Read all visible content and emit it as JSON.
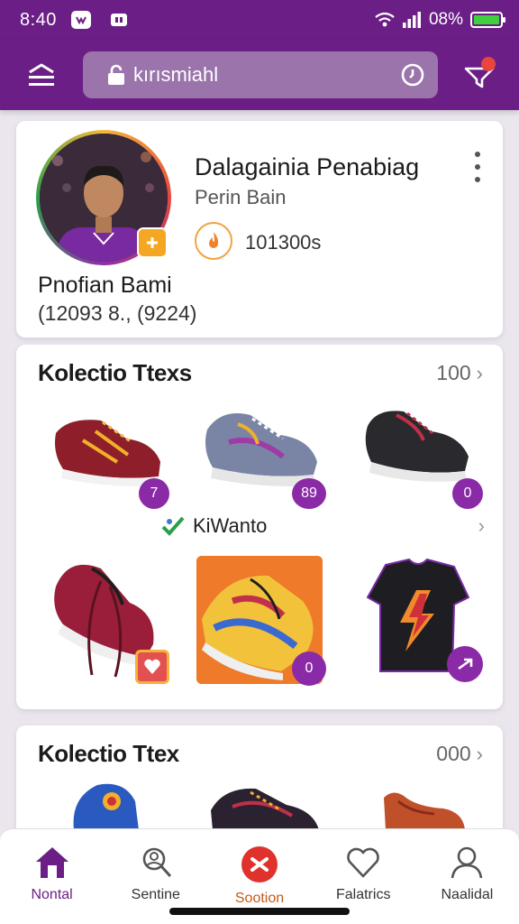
{
  "status_bar": {
    "time": "8:40",
    "battery_percent": "08%"
  },
  "header": {
    "search_text": "kırısmiahl"
  },
  "profile": {
    "title": "Dalagainia Penabiag",
    "subtitle": "Perin Bain",
    "stat_value": "101300s",
    "name": "Pnofian Bami",
    "meta": "(12093 8., (9224)"
  },
  "collection1": {
    "title": "Kolectio Ttexs",
    "count": "100",
    "badges": [
      "7",
      "89",
      "0",
      "0"
    ],
    "sub_label": "KiWanto"
  },
  "collection2": {
    "title": "Kolectio Ttex",
    "count": "000"
  },
  "nav": [
    {
      "label": "Nontal",
      "icon": "home-icon"
    },
    {
      "label": "Sentine",
      "icon": "search-people-icon"
    },
    {
      "label": "Sootion",
      "icon": "close-circle-icon"
    },
    {
      "label": "Falatrics",
      "icon": "heart-icon"
    },
    {
      "label": "Naalidal",
      "icon": "profile-icon"
    }
  ],
  "colors": {
    "brand": "#6b1f86",
    "accent": "#e0312d",
    "badge": "#8a2aa6"
  }
}
